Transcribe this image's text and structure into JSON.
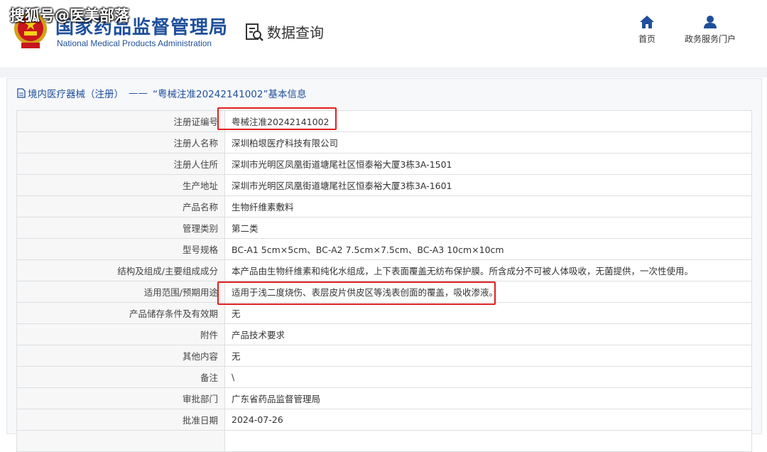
{
  "watermark": "搜狐号@医美部落",
  "header": {
    "logo_cn": "国家药品监督管理局",
    "logo_en": "National Medical Products Administration",
    "query_label": "数据查询",
    "nav": [
      {
        "label": "首页",
        "icon": "home-icon"
      },
      {
        "label": "政务服务门户",
        "icon": "user-icon"
      }
    ]
  },
  "breadcrumb": {
    "section": "境内医疗器械（注册）",
    "separator": "——",
    "record": "“粤械注准20242141002”基本信息"
  },
  "table": {
    "rows": [
      {
        "label": "注册证编号",
        "value": "粤械注准20242141002",
        "highlighted": true
      },
      {
        "label": "注册人名称",
        "value": "深圳柏垠医疗科技有限公司"
      },
      {
        "label": "注册人住所",
        "value": "深圳市光明区凤凰街道塘尾社区恒泰裕大厦3栋3A-1501"
      },
      {
        "label": "生产地址",
        "value": "深圳市光明区凤凰街道塘尾社区恒泰裕大厦3栋3A-1601"
      },
      {
        "label": "产品名称",
        "value": "生物纤维素敷料"
      },
      {
        "label": "管理类别",
        "value": "第二类"
      },
      {
        "label": "型号规格",
        "value": "BC-A1 5cm×5cm、BC-A2 7.5cm×7.5cm、BC-A3 10cm×10cm"
      },
      {
        "label": "结构及组成/主要组成成分",
        "value": "本产品由生物纤维素和纯化水组成，上下表面覆盖无纺布保护膜。所含成分不可被人体吸收，无菌提供，一次性使用。"
      },
      {
        "label": "适用范围/预期用途",
        "value": "适用于浅二度烧伤、表层皮片供皮区等浅表创面的覆盖，吸收渗液。",
        "highlighted": true
      },
      {
        "label": "产品储存条件及有效期",
        "value": "无"
      },
      {
        "label": "附件",
        "value": "产品技术要求"
      },
      {
        "label": "其他内容",
        "value": "无"
      },
      {
        "label": "备注",
        "value": "\\"
      },
      {
        "label": "审批部门",
        "value": "广东省药品监督管理局"
      },
      {
        "label": "批准日期",
        "value": "2024-07-26"
      },
      {
        "label": "",
        "value": ""
      }
    ]
  },
  "colors": {
    "brand_blue": "#1f4f9b",
    "highlight_red": "#e02020"
  }
}
